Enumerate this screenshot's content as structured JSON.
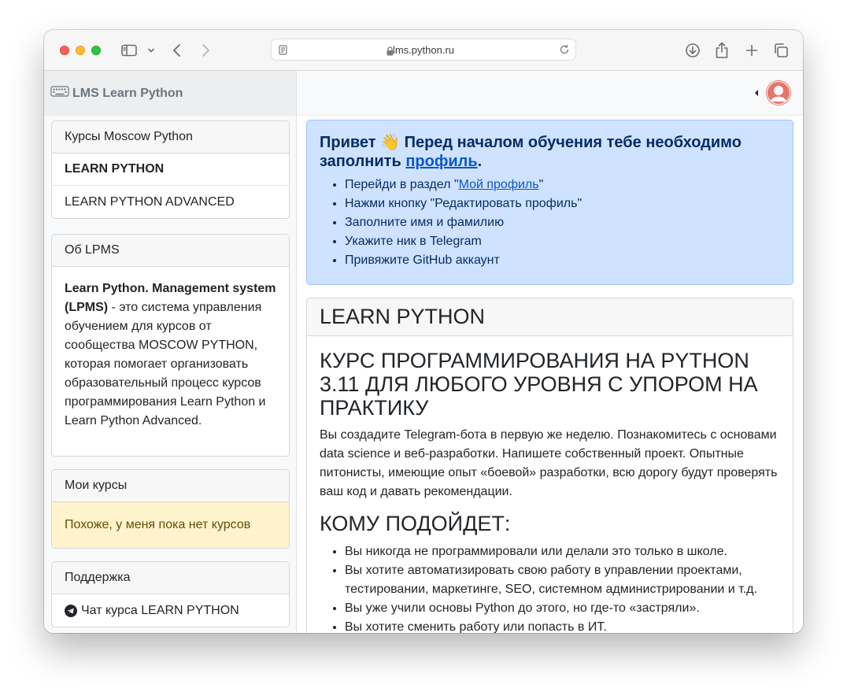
{
  "browser": {
    "url": "lms.python.ru"
  },
  "sidebar": {
    "brand": "LMS Learn Python",
    "courses_card": {
      "header": "Курсы Moscow Python",
      "items": [
        {
          "label": "LEARN PYTHON",
          "active": true
        },
        {
          "label": "LEARN PYTHON ADVANCED",
          "active": false
        }
      ]
    },
    "about_card": {
      "header": "Об LPMS",
      "bold": "Learn Python. Management system (LPMS)",
      "text": " - это система управления обучением для курсов от сообщества MOSCOW PYTHON, которая помогает организовать образовательный процесс курсов программирования Learn Python и Learn Python Advanced."
    },
    "my_courses_card": {
      "header": "Мои курсы",
      "empty_text": "Похоже, у меня пока нет курсов"
    },
    "support_card": {
      "header": "Поддержка",
      "link": "Чат курса LEARN PYTHON"
    }
  },
  "alert": {
    "title_prefix": "Привет 👋 Перед началом обучения тебе необходимо заполнить ",
    "title_link": "профиль",
    "title_suffix": ".",
    "step1_prefix": "Перейди в раздел \"",
    "step1_link": "Мой профиль",
    "step1_suffix": "\"",
    "steps": [
      "Нажми кнопку \"Редактировать профиль\"",
      "Заполните имя и фамилию",
      "Укажите ник в Telegram",
      "Привяжите GitHub аккаунт"
    ]
  },
  "course": {
    "header": "LEARN PYTHON",
    "title": "КУРС ПРОГРАММИРОВАНИЯ НА PYTHON 3.11 ДЛЯ ЛЮБОГО УРОВНЯ С УПОРОМ НА ПРАКТИКУ",
    "description": "Вы создадите Telegram-бота в первую же неделю. Познакомитесь с основами data science и веб-разработки. Напишете собственный проект. Опытные питонисты, имеющие опыт «боевой» разработки, всю дорогу будут проверять ваш код и давать рекомендации.",
    "audience_title": "КОМУ ПОДОЙДЕТ:",
    "audience": [
      "Вы никогда не программировали или делали это только в школе.",
      "Вы хотите автоматизировать свою работу в управлении проектами, тестировании, маркетинге, SEO, системном администрировании и т.д.",
      "Вы уже учили основы Python до этого, но где-то «застряли».",
      "Вы хотите сменить работу или попасть в ИТ."
    ]
  }
}
